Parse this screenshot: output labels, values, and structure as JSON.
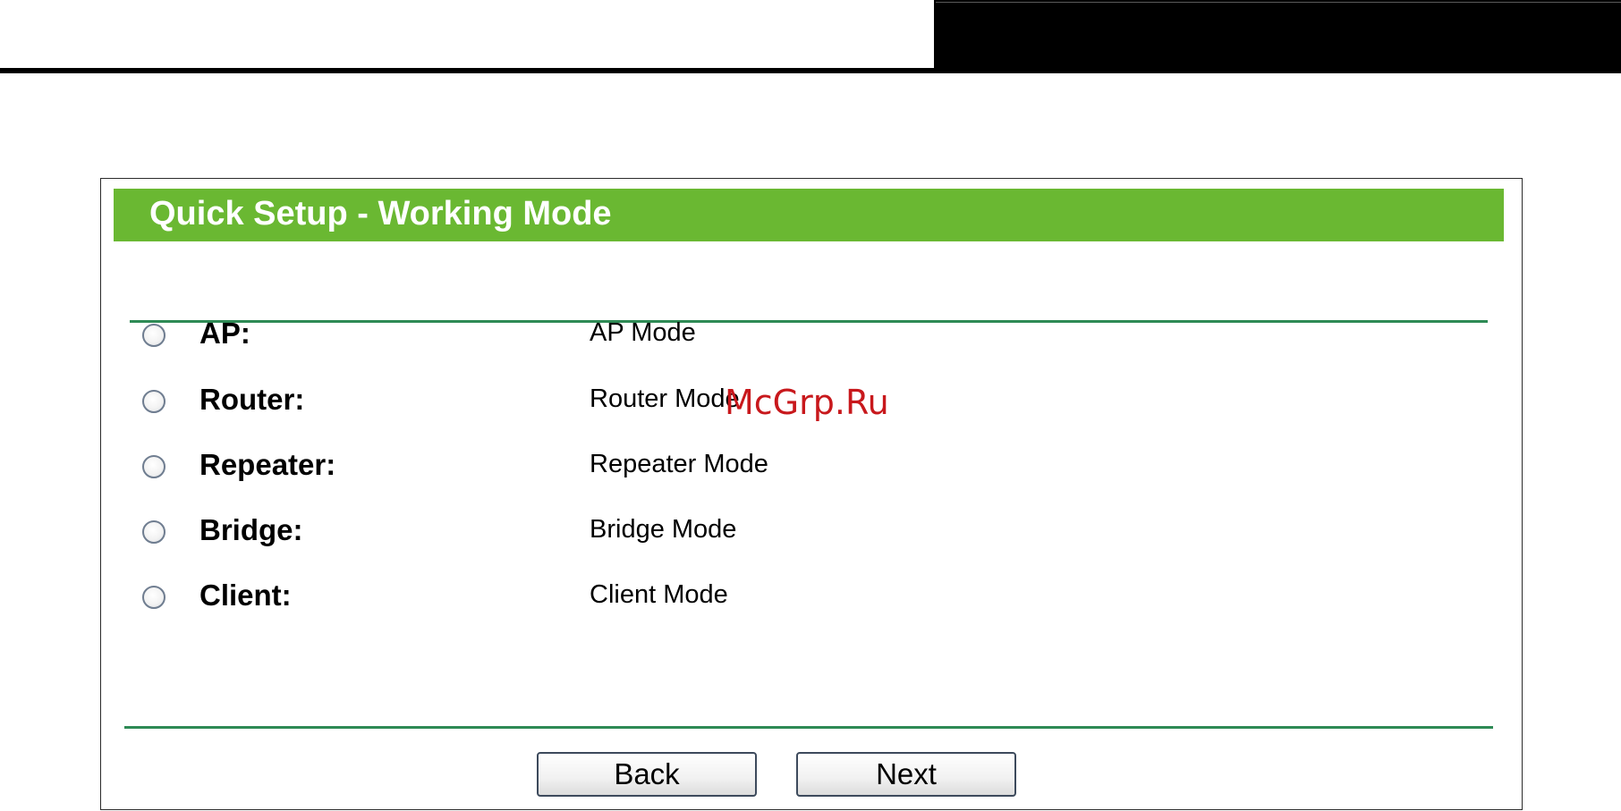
{
  "page": {
    "title": "Quick Setup - Working Mode",
    "watermark": "McGrp.Ru"
  },
  "modes": [
    {
      "label": "AP:",
      "description": "AP Mode",
      "selected": false
    },
    {
      "label": "Router:",
      "description": "Router Mode",
      "selected": false
    },
    {
      "label": "Repeater:",
      "description": "Repeater Mode",
      "selected": false
    },
    {
      "label": "Bridge:",
      "description": "Bridge Mode",
      "selected": false
    },
    {
      "label": "Client:",
      "description": "Client Mode",
      "selected": false
    }
  ],
  "buttons": {
    "back": "Back",
    "next": "Next"
  },
  "colors": {
    "title_bar": "#6ab832",
    "title_text": "#ffffff",
    "divider": "#2e8a55",
    "watermark": "#c8181c"
  }
}
